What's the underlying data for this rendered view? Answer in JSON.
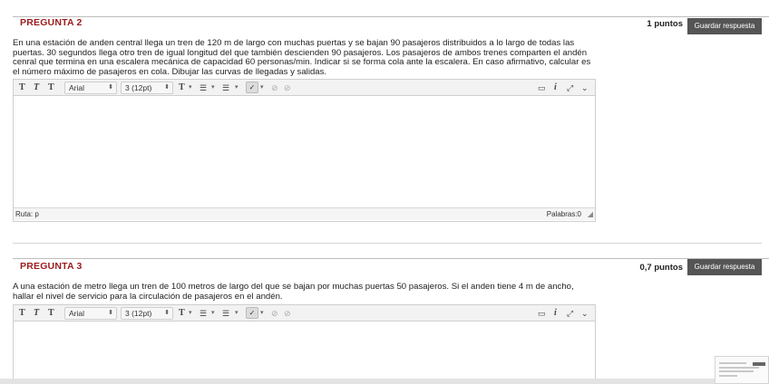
{
  "questions": [
    {
      "title": "PREGUNTA 2",
      "points": "1 puntos",
      "save_label": "Guardar respuesta",
      "text": "En una estación de anden central llega un tren de 120 m de largo con muchas puertas y se bajan  90 pasajeros distribuidos a lo largo de todas las puertas. 30 segundos llega otro tren  de igual longitud del que también descienden 90 pasajeros. Los pasajeros de ambos trenes comparten el andén cenral que termina en una escalera mecánica de capacidad 60 personas/min. Indicar si se forma cola ante la escalera. En caso afirmativo, calcular es el número máximo de pasajeros en cola. Dibujar las curvas de llegadas y salidas.",
      "status_path": "Ruta: p",
      "status_words": "Palabras:0"
    },
    {
      "title": "PREGUNTA 3",
      "points": "0,7 puntos",
      "save_label": "Guardar respuesta",
      "text": "A una estación de metro llega un tren de 100 metros de largo del que se bajan por muchas puertas 50 pasajeros. Si el anden tiene 4 m de ancho, hallar el nivel de servicio para la circulación de pasajeros en el andén."
    }
  ],
  "toolbar": {
    "font_family": "Arial",
    "font_size": "3 (12pt)",
    "icons": [
      "text-icon",
      "text-italic-icon",
      "text-format-icon",
      "text-color-icon",
      "bullet-list-icon",
      "numbered-list-icon",
      "spellcheck-icon",
      "link-icon",
      "unlink-icon",
      "preview-icon",
      "info-icon",
      "fullscreen-icon",
      "collapse-icon"
    ]
  }
}
